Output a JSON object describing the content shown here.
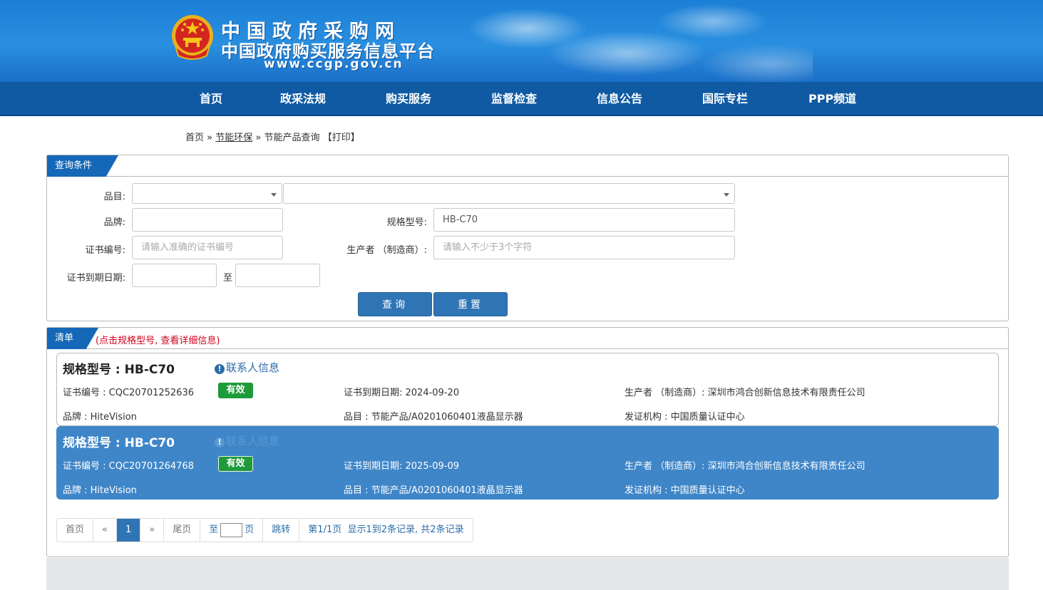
{
  "header": {
    "title": "中国政府采购网",
    "subtitle": "中国政府购买服务信息平台",
    "url": "www.ccgp.gov.cn"
  },
  "nav": [
    "首页",
    "政采法规",
    "购买服务",
    "监督检查",
    "信息公告",
    "国际专栏",
    "PPP频道"
  ],
  "breadcrumb": {
    "home": "首页",
    "sep1": "»",
    "section": "节能环保",
    "sep2": "»",
    "current": "节能产品查询",
    "print": "【打印】"
  },
  "query": {
    "tab": "查询条件",
    "category_label": "品目:",
    "category_value": "",
    "subcategory_value": "",
    "brand_label": "品牌:",
    "brand_value": "",
    "model_label": "规格型号:",
    "model_value": "HB-C70",
    "cert_label": "证书编号:",
    "cert_placeholder": "请输入准确的证书编号",
    "maker_label": "生产者 （制造商）:",
    "maker_placeholder": "请输入不少于3个字符",
    "expire_label": "证书到期日期:",
    "expire_from": "",
    "expire_to_label": "至",
    "expire_to": "",
    "search_button": "查询",
    "reset_button": "重置"
  },
  "list": {
    "tab": "清单",
    "hint": "(点击规格型号, 查看详细信息)",
    "items": [
      {
        "title": "规格型号 : HB-C70",
        "contact": "联系人信息",
        "cert": "证书编号 : CQC20701252636",
        "status": "有效",
        "expire": "证书到期日期: 2024-09-20",
        "maker": "生产者 （制造商）: 深圳市鸿合创新信息技术有限责任公司",
        "brand": "品牌 : HiteVision",
        "category": "品目 : 节能产品/A0201060401液晶显示器",
        "issuer": "发证机构 : 中国质量认证中心"
      },
      {
        "title": "规格型号 : HB-C70",
        "contact": "联系人信息",
        "cert": "证书编号 : CQC20701264768",
        "status": "有效",
        "expire": "证书到期日期: 2025-09-09",
        "maker": "生产者 （制造商）: 深圳市鸿合创新信息技术有限责任公司",
        "brand": "品牌 : HiteVision",
        "category": "品目 : 节能产品/A0201060401液晶显示器",
        "issuer": "发证机构 : 中国质量认证中心"
      }
    ]
  },
  "pager": {
    "first": "首页",
    "prev": "«",
    "current": "1",
    "next": "»",
    "last": "尾页",
    "goto_prefix": "至",
    "goto_suffix": "页",
    "jump": "跳转",
    "page_info": "第1/1页",
    "records": "显示1到2条记录, 共2条记录"
  }
}
